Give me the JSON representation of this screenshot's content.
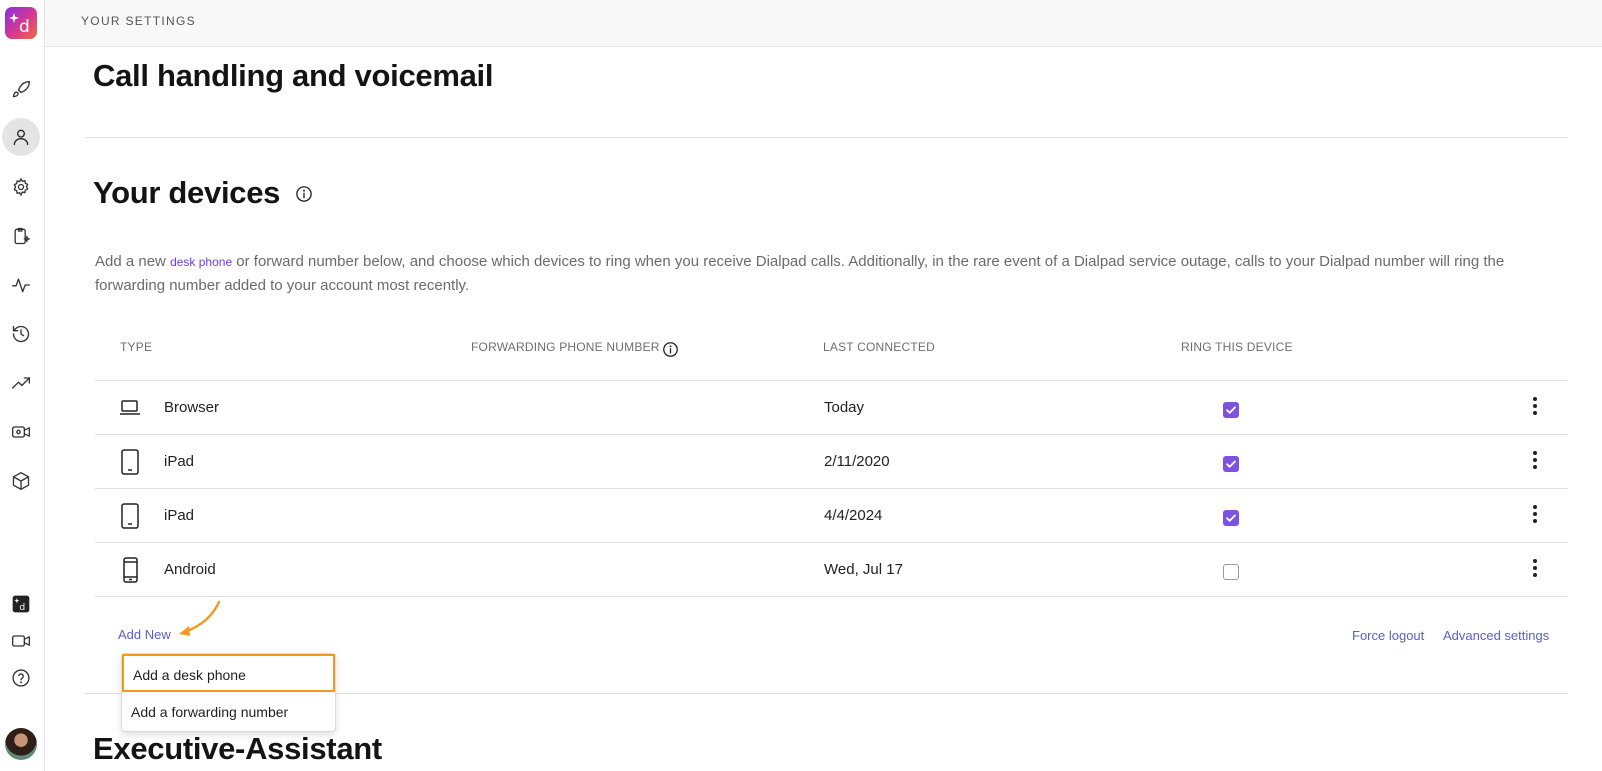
{
  "header": {
    "title": "YOUR SETTINGS"
  },
  "page": {
    "section_title": "Call handling and voicemail",
    "devices_title": "Your devices",
    "next_section_title": "Executive-Assistant"
  },
  "description": {
    "part1": "Add a new ",
    "link": "desk phone",
    "part2": " or forward number below, and choose which devices to ring when you receive Dialpad calls. Additionally, in the rare event of a Dialpad service outage, calls to your Dialpad number will ring the forwarding number added to your account most recently."
  },
  "table": {
    "headers": {
      "type": "TYPE",
      "forwarding": "FORWARDING PHONE NUMBER",
      "last_connected": "LAST CONNECTED",
      "ring": "RING THIS DEVICE"
    },
    "rows": [
      {
        "type": "Browser",
        "icon": "laptop-icon",
        "last_connected": "Today",
        "ring": true
      },
      {
        "type": "iPad",
        "icon": "tablet-icon",
        "last_connected": "2/11/2020",
        "ring": true
      },
      {
        "type": "iPad",
        "icon": "tablet-icon",
        "last_connected": "4/4/2024",
        "ring": true
      },
      {
        "type": "Android",
        "icon": "mobile-phone-icon",
        "last_connected": "Wed, Jul 17",
        "ring": false
      }
    ]
  },
  "actions": {
    "add_new": "Add New",
    "force_logout": "Force logout",
    "advanced_settings": "Advanced settings"
  },
  "dropdown": {
    "items": [
      "Add a desk phone",
      "Add a forwarding number"
    ]
  },
  "colors": {
    "accent": "#7c52e0",
    "link": "#5a5fc7",
    "highlight": "#f39a1e"
  }
}
